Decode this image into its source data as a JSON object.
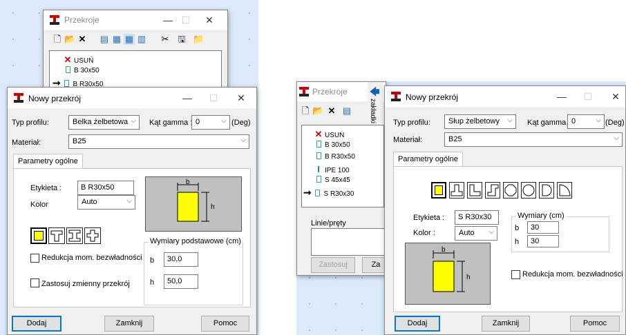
{
  "left": {
    "przekroje": {
      "title": "Przekroje",
      "list": [
        {
          "label": "USUŃ",
          "icon": "x-mark-icon"
        },
        {
          "label": "B 30x50",
          "icon": "rectangle-section-icon"
        },
        {
          "label": "B R30x50",
          "icon": "rectangle-section-icon",
          "current": true
        }
      ]
    },
    "dialog": {
      "title": "Nowy przekrój",
      "typ_profilu_label": "Typ profilu:",
      "typ_profilu_value": "Belka żelbetowa",
      "kat_label": "Kąt gamma :",
      "kat_value": "0",
      "kat_unit": "(Deg)",
      "material_label": "Materiał:",
      "material_value": "B25",
      "tab": "Parametry ogólne",
      "etykieta_label": "Etykieta :",
      "etykieta_value": "B R30x50",
      "kolor_label": "Kolor",
      "kolor_value": "Auto",
      "preview_b": "b",
      "preview_h": "h",
      "redukcja_label": "Redukcja mom. bezwładności",
      "zmienny_label": "Zastosuj zmienny przekrój",
      "wymiary_title": "Wymiary podstawowe (cm)",
      "b_label": "b",
      "b_value": "30,0",
      "h_label": "h",
      "h_value": "50,0",
      "dodaj": "Dodaj",
      "zamknij": "Zamknij",
      "pomoc": "Pomoc"
    }
  },
  "right": {
    "przekroje": {
      "title": "Przekroje",
      "zakladki": "zakładki",
      "list": [
        {
          "label": "USUŃ",
          "icon": "x-mark-icon"
        },
        {
          "label": "B 30x50",
          "icon": "rectangle-section-icon"
        },
        {
          "label": "B R30x50",
          "icon": "rectangle-section-icon"
        },
        {
          "label": "IPE 100",
          "icon": "i-beam-icon"
        },
        {
          "label": "S 45x45",
          "icon": "rectangle-section-icon"
        },
        {
          "label": "S R30x30",
          "icon": "rectangle-section-icon",
          "current": true
        }
      ],
      "linie_label": "Linie/pręty",
      "zastosuj": "Zastosuj",
      "za": "Za"
    },
    "dialog": {
      "title": "Nowy przekrój",
      "typ_profilu_label": "Typ profilu:",
      "typ_profilu_value": "Słup żelbetowy",
      "kat_label": "Kąt gamma :",
      "kat_value": "0",
      "kat_unit": "(Deg)",
      "material_label": "Materiał:",
      "material_value": "B25",
      "tab": "Parametry ogólne",
      "etykieta_label": "Etykieta :",
      "etykieta_value": "S R30x30",
      "kolor_label": "Kolor :",
      "kolor_value": "Auto",
      "wymiary_title": "Wymiary (cm)",
      "b_label": "b",
      "b_value": "30",
      "h_label": "h",
      "h_value": "30",
      "preview_b": "b",
      "preview_h": "h",
      "redukcja_label": "Redukcja mom. bezwładności",
      "dodaj": "Dodaj",
      "zamknij": "Zamknij",
      "pomoc": "Pomoc"
    }
  },
  "colors": {
    "section_fill": "#ffff00",
    "workspace": "#dbe9fb",
    "accent": "#0078d7"
  }
}
